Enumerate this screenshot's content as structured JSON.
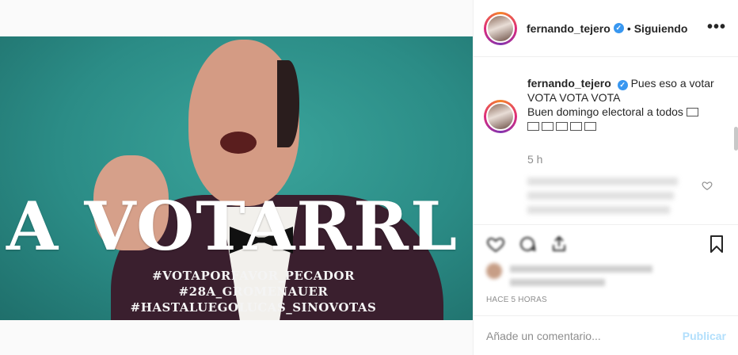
{
  "post": {
    "image": {
      "overlay_text": "A VOTARRL",
      "hashtag_line_1": "#VOTAPORFAVOR_PECADOR #28A_GROMENAUER",
      "hashtag_line_2": "#HASTALUEGOLUCAS_SINOVOTAS",
      "background_color": "#2a8f8a"
    }
  },
  "header": {
    "username": "fernando_tejero",
    "verified_icon": "verified-badge-icon",
    "separator": "•",
    "follow_state": "Siguiendo",
    "more_label": "•••"
  },
  "caption": {
    "username": "fernando_tejero",
    "line_1": "Pues eso a votar",
    "line_2": "VOTA VOTA VOTA",
    "line_3": "Buen domingo electoral a todos",
    "time_ago": "5 h"
  },
  "actions": {
    "like_icon": "heart-icon",
    "comment_icon": "comment-icon",
    "share_icon": "share-icon",
    "save_icon": "bookmark-icon",
    "post_date": "HACE 5 HORAS"
  },
  "comment_box": {
    "placeholder": "Añade un comentario...",
    "publish_label": "Publicar"
  },
  "colors": {
    "accent_blue": "#3897f0",
    "publish_disabled": "#b2dffc",
    "secondary_text": "#8e8e8e"
  }
}
